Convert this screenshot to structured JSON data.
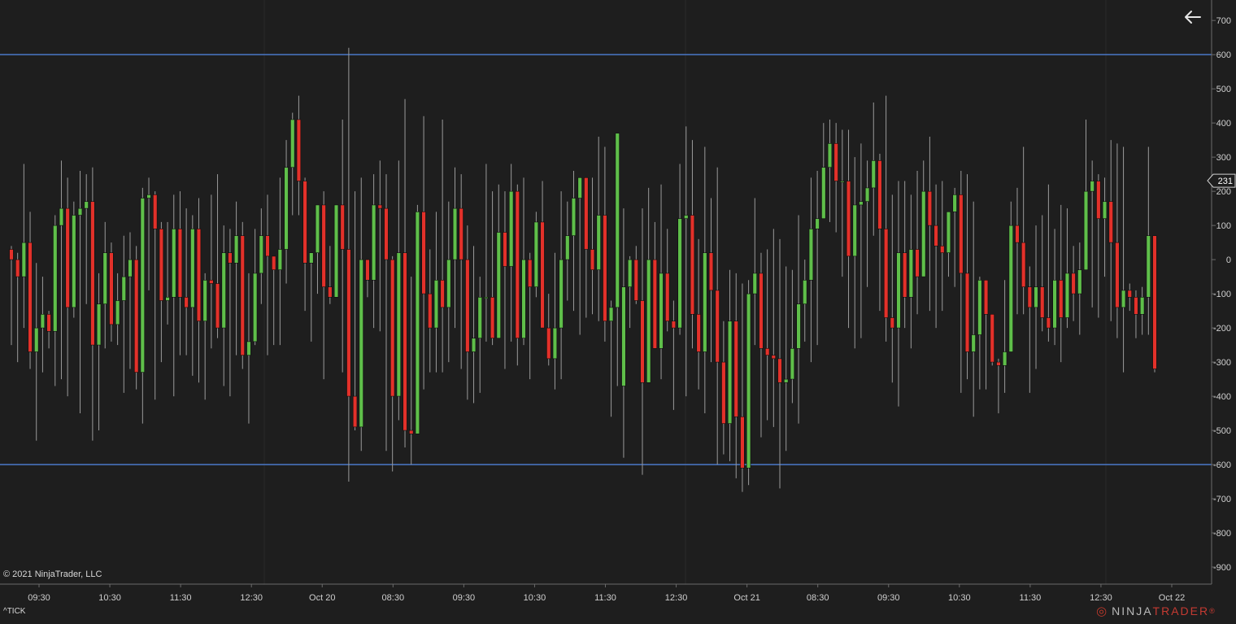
{
  "chart_data": {
    "type": "candlestick",
    "instrument": "^TICK",
    "ylim": [
      -950,
      760
    ],
    "yticks": [
      700,
      600,
      500,
      400,
      300,
      200,
      100,
      0,
      -100,
      -200,
      -300,
      -400,
      -500,
      -600,
      -700,
      -800,
      -900
    ],
    "ytick_labels": [
      "700",
      "600",
      "500",
      "400",
      "300",
      "200",
      "100",
      "0",
      "-100",
      "-200",
      "-300",
      "-400",
      "-500",
      "-600",
      "-700",
      "-800",
      "-900"
    ],
    "xtick_labels": [
      "09:30",
      "10:30",
      "11:30",
      "12:30",
      "Oct 20",
      "08:30",
      "09:30",
      "10:30",
      "11:30",
      "12:30",
      "Oct 21",
      "08:30",
      "09:30",
      "10:30",
      "11:30",
      "12:30",
      "Oct 22"
    ],
    "last_price": 231,
    "horizontal_lines": [
      600,
      -600
    ],
    "candles": [
      [
        30,
        0,
        40,
        -250
      ],
      [
        0,
        -50,
        20,
        -300
      ],
      [
        -50,
        50,
        280,
        -200
      ],
      [
        50,
        -270,
        140,
        -320
      ],
      [
        -270,
        -200,
        -10,
        -530
      ],
      [
        -200,
        -160,
        -50,
        -330
      ],
      [
        -160,
        -210,
        -150,
        -260
      ],
      [
        -210,
        100,
        130,
        -370
      ],
      [
        100,
        150,
        290,
        -350
      ],
      [
        150,
        -140,
        240,
        -400
      ],
      [
        -140,
        130,
        170,
        -170
      ],
      [
        130,
        150,
        260,
        -450
      ],
      [
        150,
        170,
        250,
        -130
      ],
      [
        170,
        -250,
        270,
        -530
      ],
      [
        -250,
        -130,
        -40,
        -500
      ],
      [
        -130,
        20,
        110,
        -260
      ],
      [
        20,
        -190,
        50,
        -240
      ],
      [
        -190,
        -120,
        -40,
        -250
      ],
      [
        -120,
        -50,
        70,
        -390
      ],
      [
        -50,
        0,
        80,
        -320
      ],
      [
        0,
        -330,
        40,
        -380
      ],
      [
        -330,
        180,
        210,
        -480
      ],
      [
        180,
        190,
        240,
        -90
      ],
      [
        190,
        90,
        200,
        -410
      ],
      [
        90,
        -120,
        110,
        -300
      ],
      [
        -120,
        -110,
        110,
        -190
      ],
      [
        -110,
        90,
        190,
        -400
      ],
      [
        90,
        -110,
        200,
        -280
      ],
      [
        -110,
        -140,
        150,
        -280
      ],
      [
        -140,
        90,
        130,
        -340
      ],
      [
        90,
        -180,
        180,
        -360
      ],
      [
        -180,
        -60,
        -40,
        -410
      ],
      [
        -60,
        -70,
        190,
        -260
      ],
      [
        -70,
        -200,
        250,
        -230
      ],
      [
        -200,
        20,
        100,
        -370
      ],
      [
        20,
        -10,
        90,
        -400
      ],
      [
        -10,
        70,
        170,
        -280
      ],
      [
        70,
        -280,
        110,
        -320
      ],
      [
        -280,
        -240,
        -40,
        -480
      ],
      [
        -240,
        -40,
        90,
        -250
      ],
      [
        -40,
        70,
        150,
        -130
      ],
      [
        70,
        10,
        190,
        -280
      ],
      [
        10,
        -30,
        -10,
        -250
      ],
      [
        -30,
        30,
        240,
        -250
      ],
      [
        30,
        270,
        350,
        -70
      ],
      [
        270,
        410,
        430,
        130
      ],
      [
        410,
        230,
        480,
        130
      ],
      [
        230,
        -10,
        240,
        -150
      ],
      [
        -10,
        20,
        20,
        -240
      ],
      [
        20,
        160,
        160,
        -100
      ],
      [
        160,
        -80,
        200,
        -350
      ],
      [
        -80,
        -110,
        40,
        -130
      ],
      [
        -110,
        160,
        160,
        -90
      ],
      [
        160,
        30,
        410,
        -330
      ],
      [
        30,
        -400,
        620,
        -650
      ],
      [
        -400,
        -490,
        200,
        -500
      ],
      [
        -490,
        0,
        240,
        -560
      ],
      [
        0,
        -60,
        -20,
        -110
      ],
      [
        -60,
        160,
        250,
        -200
      ],
      [
        160,
        150,
        290,
        -210
      ],
      [
        150,
        0,
        250,
        -560
      ],
      [
        0,
        -400,
        10,
        -620
      ],
      [
        -400,
        20,
        290,
        -470
      ],
      [
        20,
        -500,
        470,
        -550
      ],
      [
        -500,
        -510,
        -50,
        -600
      ],
      [
        -510,
        140,
        160,
        -310
      ],
      [
        140,
        -100,
        420,
        -380
      ],
      [
        -100,
        -200,
        30,
        -330
      ],
      [
        -200,
        -60,
        140,
        -330
      ],
      [
        -60,
        -140,
        410,
        -330
      ],
      [
        -140,
        0,
        170,
        -300
      ],
      [
        0,
        150,
        270,
        -200
      ],
      [
        150,
        0,
        250,
        -320
      ],
      [
        0,
        -270,
        100,
        -410
      ],
      [
        -270,
        -230,
        40,
        -420
      ],
      [
        -230,
        -110,
        -50,
        -390
      ],
      [
        -110,
        -110,
        280,
        -240
      ],
      [
        -110,
        -230,
        200,
        -250
      ],
      [
        -230,
        80,
        220,
        -230
      ],
      [
        80,
        -20,
        200,
        -320
      ],
      [
        -20,
        200,
        280,
        -240
      ],
      [
        200,
        -230,
        220,
        -310
      ],
      [
        -230,
        0,
        240,
        -250
      ],
      [
        0,
        -80,
        20,
        -350
      ],
      [
        -80,
        110,
        140,
        -110
      ],
      [
        110,
        -200,
        230,
        -150
      ],
      [
        -200,
        -290,
        -100,
        -310
      ],
      [
        -290,
        -200,
        20,
        -380
      ],
      [
        -200,
        0,
        200,
        -350
      ],
      [
        0,
        70,
        170,
        -120
      ],
      [
        70,
        180,
        260,
        -150
      ],
      [
        180,
        240,
        230,
        -220
      ],
      [
        240,
        30,
        120,
        -170
      ],
      [
        30,
        -30,
        240,
        -160
      ],
      [
        -30,
        130,
        360,
        -180
      ],
      [
        130,
        -180,
        330,
        -240
      ],
      [
        -180,
        -140,
        -120,
        -460
      ],
      [
        -140,
        370,
        370,
        -370
      ],
      [
        -370,
        -80,
        150,
        -580
      ],
      [
        -80,
        0,
        10,
        -200
      ],
      [
        0,
        -120,
        40,
        -130
      ],
      [
        -120,
        -360,
        150,
        -630
      ],
      [
        -360,
        0,
        210,
        -220
      ],
      [
        0,
        -260,
        110,
        -170
      ],
      [
        -260,
        -40,
        220,
        -350
      ],
      [
        -40,
        -180,
        90,
        -210
      ],
      [
        -180,
        -200,
        -120,
        -440
      ],
      [
        -200,
        120,
        280,
        -220
      ],
      [
        120,
        130,
        390,
        -400
      ],
      [
        130,
        -160,
        350,
        -260
      ],
      [
        -160,
        -270,
        60,
        -380
      ],
      [
        -270,
        20,
        330,
        -450
      ],
      [
        20,
        -90,
        180,
        -300
      ],
      [
        -90,
        -300,
        270,
        -600
      ],
      [
        -300,
        -480,
        -180,
        -570
      ],
      [
        -480,
        -180,
        -30,
        -590
      ],
      [
        -180,
        -460,
        -40,
        -640
      ],
      [
        -460,
        -610,
        -70,
        -680
      ],
      [
        -610,
        -100,
        -60,
        -660
      ],
      [
        -100,
        -40,
        180,
        -250
      ],
      [
        -40,
        -260,
        20,
        -520
      ],
      [
        -260,
        -280,
        30,
        -470
      ],
      [
        -280,
        -290,
        90,
        -490
      ],
      [
        -290,
        -360,
        60,
        -670
      ],
      [
        -360,
        -350,
        -20,
        -560
      ],
      [
        -350,
        -260,
        -30,
        -420
      ],
      [
        -260,
        -130,
        130,
        -480
      ],
      [
        -130,
        -60,
        0,
        -240
      ],
      [
        -60,
        90,
        240,
        -300
      ],
      [
        90,
        120,
        260,
        -250
      ],
      [
        120,
        270,
        400,
        120
      ],
      [
        270,
        340,
        410,
        110
      ],
      [
        340,
        230,
        400,
        80
      ],
      [
        230,
        230,
        380,
        -50
      ],
      [
        230,
        10,
        380,
        -200
      ],
      [
        10,
        160,
        300,
        -260
      ],
      [
        160,
        170,
        340,
        -230
      ],
      [
        170,
        210,
        290,
        -80
      ],
      [
        210,
        290,
        460,
        70
      ],
      [
        290,
        90,
        310,
        -150
      ],
      [
        90,
        -170,
        480,
        -240
      ],
      [
        -170,
        -200,
        190,
        -360
      ],
      [
        -200,
        20,
        230,
        -430
      ],
      [
        20,
        -110,
        230,
        -200
      ],
      [
        -110,
        30,
        190,
        -260
      ],
      [
        30,
        -50,
        260,
        -160
      ],
      [
        -50,
        200,
        290,
        80
      ],
      [
        200,
        100,
        360,
        -150
      ],
      [
        100,
        40,
        220,
        -200
      ],
      [
        40,
        20,
        230,
        -150
      ],
      [
        20,
        140,
        140,
        -50
      ],
      [
        140,
        190,
        210,
        -80
      ],
      [
        190,
        -40,
        260,
        -390
      ],
      [
        -40,
        -270,
        250,
        -350
      ],
      [
        -270,
        -220,
        170,
        -460
      ],
      [
        -220,
        -60,
        -50,
        -380
      ],
      [
        -60,
        -160,
        -60,
        -380
      ],
      [
        -160,
        -300,
        -160,
        -310
      ],
      [
        -300,
        -310,
        -290,
        -450
      ],
      [
        -310,
        -270,
        -60,
        -390
      ],
      [
        -270,
        100,
        170,
        -140
      ],
      [
        100,
        50,
        210,
        -160
      ],
      [
        50,
        -80,
        330,
        -160
      ],
      [
        -80,
        -140,
        -20,
        -390
      ],
      [
        -140,
        -80,
        100,
        -320
      ],
      [
        -80,
        -170,
        130,
        -210
      ],
      [
        -170,
        -200,
        220,
        -240
      ],
      [
        -200,
        -60,
        90,
        -250
      ],
      [
        -60,
        -170,
        160,
        -300
      ],
      [
        -170,
        -40,
        150,
        -200
      ],
      [
        -40,
        -100,
        40,
        -180
      ],
      [
        -100,
        -30,
        50,
        -220
      ],
      [
        -30,
        200,
        410,
        150
      ],
      [
        200,
        230,
        290,
        -140
      ],
      [
        230,
        120,
        250,
        -170
      ],
      [
        120,
        170,
        240,
        -50
      ],
      [
        170,
        50,
        350,
        -180
      ],
      [
        50,
        -140,
        340,
        -230
      ],
      [
        -140,
        -90,
        330,
        -330
      ],
      [
        -90,
        -110,
        -70,
        -150
      ],
      [
        -110,
        -160,
        -90,
        -230
      ],
      [
        -160,
        -110,
        -80,
        -220
      ],
      [
        -110,
        70,
        330,
        -220
      ],
      [
        70,
        -320,
        -310,
        -330
      ]
    ]
  },
  "ui": {
    "copyright": "© 2021 NinjaTrader, LLC",
    "instrument_label": "^TICK",
    "brand_ninja": "NINJA",
    "brand_trader": "TRADER",
    "brand_reg": "®",
    "back_icon": "arrow-left-icon",
    "colors": {
      "background": "#1e1e1e",
      "up": "#5fbf4a",
      "down": "#e3312a",
      "wick": "#9a9a9a",
      "hline": "#4a78c8",
      "axis_text": "#cfcfcf",
      "price_marker_bg": "#1e1e1e"
    }
  }
}
